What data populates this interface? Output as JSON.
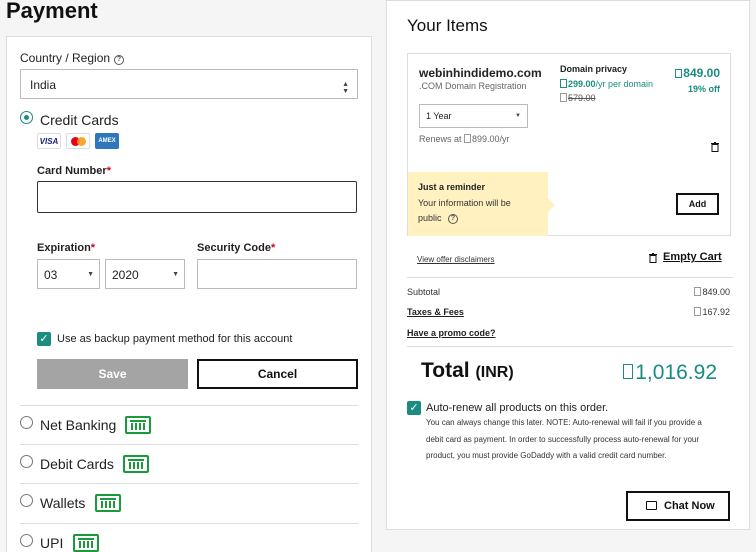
{
  "page": {
    "title": "Payment"
  },
  "payment": {
    "country_label": "Country / Region",
    "country_value": "India",
    "credit_cards_label": "Credit Cards",
    "card_logos": [
      "VISA",
      "MASTERCARD",
      "AMEX"
    ],
    "card_number_label": "Card Number",
    "required_mark": "*",
    "expiration_label": "Expiration",
    "expiration_month": "03",
    "expiration_year": "2020",
    "security_code_label": "Security Code",
    "backup_label": "Use as backup payment method for this account",
    "backup_checked": true,
    "save_label": "Save",
    "cancel_label": "Cancel",
    "methods": [
      {
        "label": "Net Banking"
      },
      {
        "label": "Debit Cards"
      },
      {
        "label": "Wallets"
      },
      {
        "label": "UPI"
      }
    ]
  },
  "items": {
    "title": "Your Items",
    "domain": ".webinhindidemo.com",
    "domain_text": "webinhindidemo.com",
    "description": ".COM Domain Registration",
    "price": "849.00",
    "discount": "19% off",
    "term": "1 Year",
    "renews": "Renews at ",
    "renews_price": "899.00/yr",
    "reminder_title": "Just a reminder",
    "reminder_text": "Your information will be public",
    "privacy_title": "Domain privacy",
    "privacy_price": "299.00",
    "privacy_unit": "/yr per domain",
    "privacy_old_price": "579.00",
    "add_label": "Add"
  },
  "summary": {
    "disclaimers": "View offer disclaimers",
    "empty_cart": "Empty Cart",
    "subtotal_label": "Subtotal",
    "subtotal_value": "849.00",
    "taxes_label": "Taxes & Fees",
    "taxes_value": "167.92",
    "promo_label": "Have a promo code?",
    "total_label": "Total",
    "total_unit": "(INR)",
    "total_value": "1,016.92",
    "auto_renew_label": "Auto-renew all products on this order.",
    "auto_renew_checked": true,
    "auto_renew_text": "You can always change this later. NOTE: Auto-renewal will fail if you provide a debit card as payment. In order to successfully process auto-renewal for your product, you must provide GoDaddy with a valid credit card number."
  },
  "chat": {
    "label": "Chat Now"
  },
  "colors": {
    "accent": "#1b8c80",
    "bank_green": "#1b9a3c",
    "reminder_bg": "#fff2c0",
    "required": "#d0021b"
  }
}
